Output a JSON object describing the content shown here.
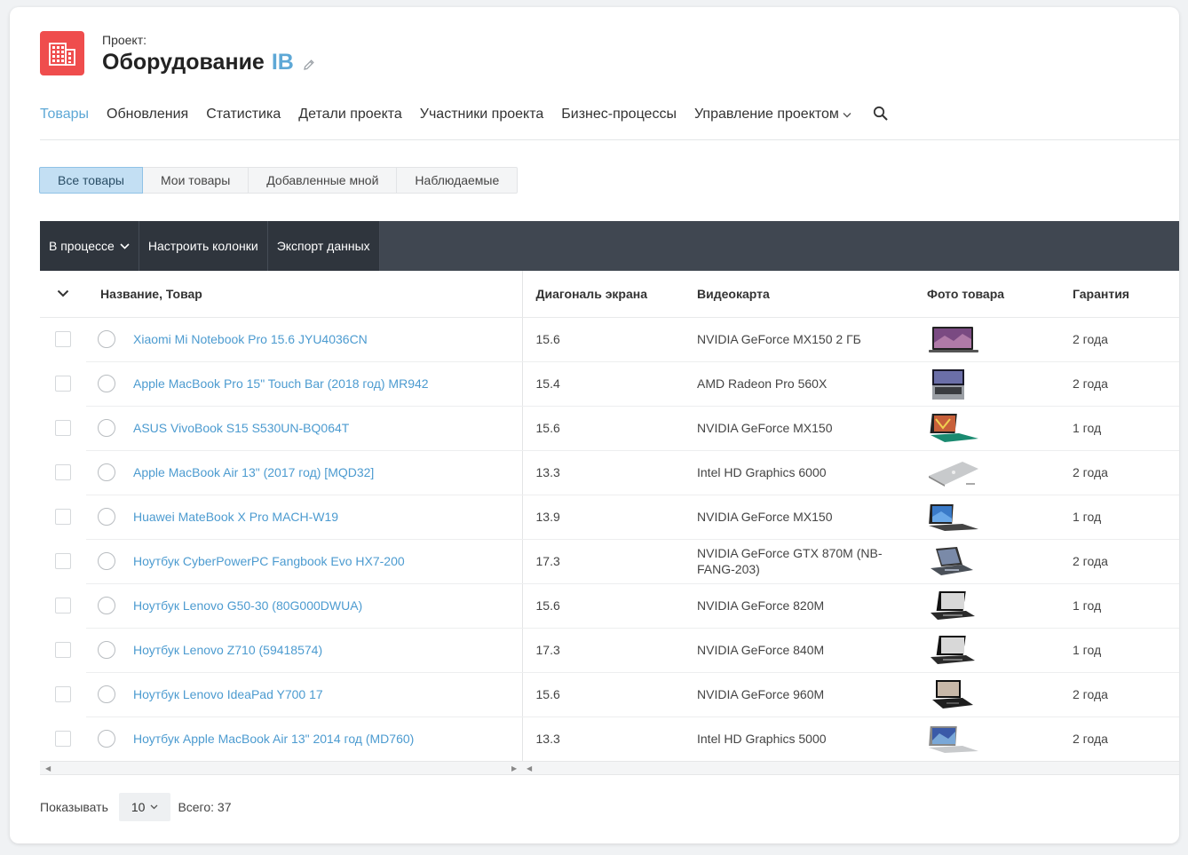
{
  "project": {
    "label": "Проект:",
    "title": "Оборудование",
    "title_accent": "IB"
  },
  "nav": {
    "items": [
      {
        "label": "Товары",
        "active": true
      },
      {
        "label": "Обновления"
      },
      {
        "label": "Статистика"
      },
      {
        "label": "Детали проекта"
      },
      {
        "label": "Участники проекта"
      },
      {
        "label": "Бизнес-процессы"
      },
      {
        "label": "Управление проектом"
      }
    ]
  },
  "filters": [
    "Все товары",
    "Мои товары",
    "Добавленные мной",
    "Наблюдаемые"
  ],
  "toolbar": {
    "process": "В процессе",
    "columns": "Настроить колонки",
    "export": "Экспорт данных"
  },
  "table": {
    "headers": {
      "name": "Название, Товар",
      "diag": "Диагональ экрана",
      "gpu": "Видеокарта",
      "photo": "Фото товара",
      "warranty": "Гарантия"
    },
    "rows": [
      {
        "name": "Xiaomi Mi Notebook Pro 15.6 JYU4036CN",
        "diag": "15.6",
        "gpu": "NVIDIA GeForce MX150 2 ГБ",
        "warranty": "2 года",
        "thumb": "laptop-open-purple"
      },
      {
        "name": "Apple MacBook Pro 15\" Touch Bar (2018 год) MR942",
        "diag": "15.4",
        "gpu": "AMD Radeon Pro 560X",
        "warranty": "2 года",
        "thumb": "laptop-top-gray"
      },
      {
        "name": "ASUS VivoBook S15 S530UN-BQ064T",
        "diag": "15.6",
        "gpu": "NVIDIA GeForce MX150",
        "warranty": "1 год",
        "thumb": "laptop-open-green"
      },
      {
        "name": "Apple MacBook Air 13\" (2017 год) [MQD32]",
        "diag": "13.3",
        "gpu": "Intel HD Graphics 6000",
        "warranty": "2 года",
        "thumb": "laptop-closed-silver"
      },
      {
        "name": "Huawei MateBook X Pro MACH-W19",
        "diag": "13.9",
        "gpu": "NVIDIA GeForce MX150",
        "warranty": "1 год",
        "thumb": "laptop-open-blue"
      },
      {
        "name": "Ноутбук CyberPowerPC Fangbook Evo HX7-200",
        "diag": "17.3",
        "gpu": "NVIDIA GeForce GTX 870M (NB-FANG-203)",
        "warranty": "2 года",
        "thumb": "laptop-gaming-dark"
      },
      {
        "name": "Ноутбук Lenovo G50-30 (80G000DWUA)",
        "diag": "15.6",
        "gpu": "NVIDIA GeForce 820M",
        "warranty": "1 год",
        "thumb": "laptop-open-black"
      },
      {
        "name": "Ноутбук Lenovo Z710 (59418574)",
        "diag": "17.3",
        "gpu": "NVIDIA GeForce 840M",
        "warranty": "1 год",
        "thumb": "laptop-open-black"
      },
      {
        "name": "Ноутбук Lenovo IdeaPad Y700 17",
        "diag": "15.6",
        "gpu": "NVIDIA GeForce 960M",
        "warranty": "2 года",
        "thumb": "laptop-open-dark"
      },
      {
        "name": "Ноутбук Apple MacBook Air 13\" 2014 год (MD760)",
        "diag": "13.3",
        "gpu": "Intel HD Graphics 5000",
        "warranty": "2 года",
        "thumb": "laptop-open-silver"
      }
    ]
  },
  "footer": {
    "show_label": "Показывать",
    "page_size": "10",
    "total": "Всего: 37"
  },
  "colors": {
    "accent": "#5ea8d6",
    "link": "#4c9bd0",
    "project_icon": "#ef4d4d",
    "toolbar": "#2f353d"
  }
}
